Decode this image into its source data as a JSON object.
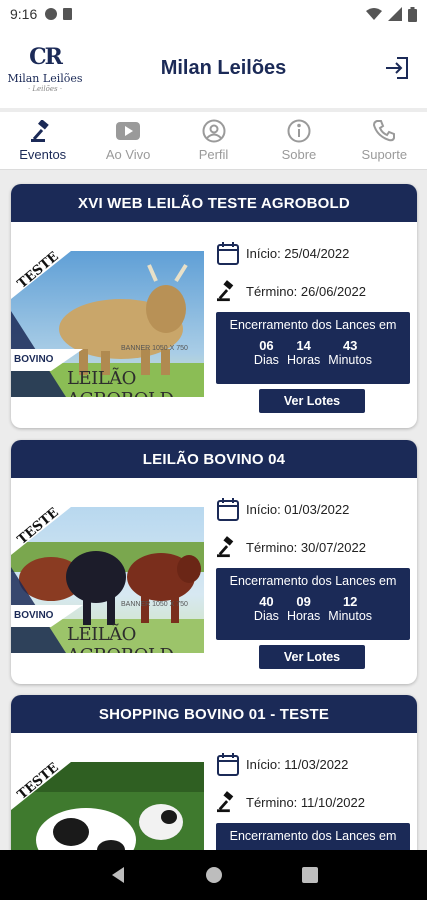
{
  "status_bar": {
    "time": "9:16"
  },
  "header": {
    "logo_monogram": "CR",
    "logo_text": "Milan Leilões",
    "logo_script": "· Leilões ·",
    "title": "Milan Leilões",
    "exit_icon": "logout-icon"
  },
  "tabs": [
    {
      "label": "Eventos",
      "icon": "gavel-icon",
      "active": true
    },
    {
      "label": "Ao Vivo",
      "icon": "play-icon",
      "active": false
    },
    {
      "label": "Perfil",
      "icon": "user-icon",
      "active": false
    },
    {
      "label": "Sobre",
      "icon": "info-icon",
      "active": false
    },
    {
      "label": "Suporte",
      "icon": "phone-icon",
      "active": false
    }
  ],
  "colors": {
    "primary": "#1b2a57",
    "tab_inactive": "#9a9a9a",
    "background": "#ececec"
  },
  "events": [
    {
      "title": "XVI WEB LEILÃO TESTE AGROBOLD",
      "start": "Início: 25/04/2022",
      "end": "Término: 26/06/2022",
      "countdown_label": "Encerramento dos Lances em",
      "days": "06",
      "days_unit": "Dias",
      "hours": "14",
      "hours_unit": "Horas",
      "minutes": "43",
      "minutes_unit": "Minutos",
      "button": "Ver Lotes",
      "banner_tag": "TESTE",
      "banner_category": "BOVINO",
      "banner_brand": "LEILÃO AGROBOLD",
      "banner_size": "BANNER 1050 X 750"
    },
    {
      "title": "LEILÃO BOVINO 04",
      "start": "Início: 01/03/2022",
      "end": "Término: 30/07/2022",
      "countdown_label": "Encerramento dos Lances em",
      "days": "40",
      "days_unit": "Dias",
      "hours": "09",
      "hours_unit": "Horas",
      "minutes": "12",
      "minutes_unit": "Minutos",
      "button": "Ver Lotes",
      "banner_tag": "TESTE",
      "banner_category": "BOVINO",
      "banner_brand": "LEILÃO AGROBOLD",
      "banner_size": "BANNER 1050 X 750"
    },
    {
      "title": "SHOPPING BOVINO 01 - TESTE",
      "start": "Início: 11/03/2022",
      "end": "Término: 11/10/2022",
      "countdown_label": "Encerramento dos Lances em",
      "banner_tag": "TESTE"
    }
  ]
}
